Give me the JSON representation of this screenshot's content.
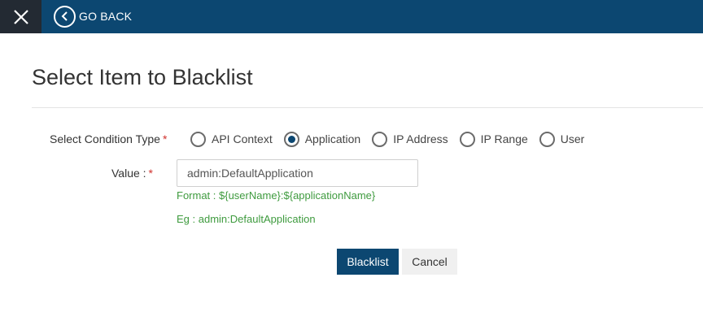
{
  "topbar": {
    "close_icon": "close-icon",
    "go_back_label": "GO BACK",
    "back_icon": "chevron-left-icon"
  },
  "page": {
    "title": "Select Item to Blacklist"
  },
  "form": {
    "condition_type": {
      "label": "Select Condition Type",
      "required_mark": "*",
      "options": [
        {
          "label": "API Context",
          "selected": false
        },
        {
          "label": "Application",
          "selected": true
        },
        {
          "label": "IP Address",
          "selected": false
        },
        {
          "label": "IP Range",
          "selected": false
        },
        {
          "label": "User",
          "selected": false
        }
      ]
    },
    "value": {
      "label": "Value :",
      "required_mark": "*",
      "current_value": "admin:DefaultApplication",
      "format_hint": "Format : ${userName}:${applicationName}",
      "example_hint": "Eg : admin:DefaultApplication"
    }
  },
  "actions": {
    "blacklist_label": "Blacklist",
    "cancel_label": "Cancel"
  },
  "colors": {
    "topbar": "#0c4771",
    "close_box": "#232a33",
    "primary": "#0c4771",
    "hint_green": "#3f9b3f",
    "required_red": "#d0312d"
  }
}
